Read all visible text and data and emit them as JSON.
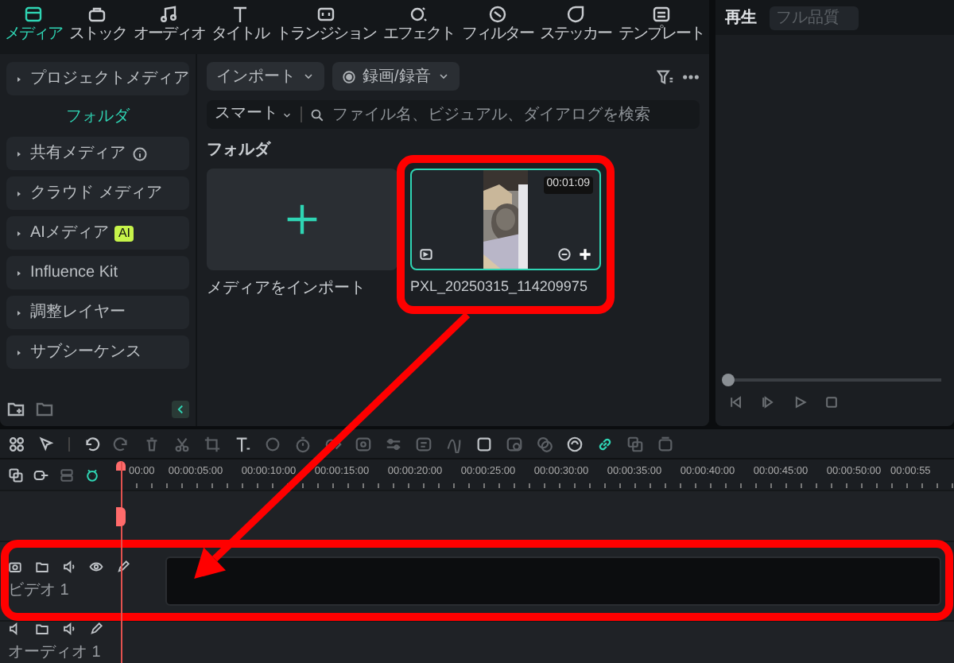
{
  "top_tabs": [
    {
      "label": "メディア",
      "selected": true
    },
    {
      "label": "ストック",
      "selected": false
    },
    {
      "label": "オーディオ",
      "selected": false
    },
    {
      "label": "タイトル",
      "selected": false
    },
    {
      "label": "トランジション",
      "selected": false
    },
    {
      "label": "エフェクト",
      "selected": false
    },
    {
      "label": "フィルター",
      "selected": false
    },
    {
      "label": "ステッカー",
      "selected": false
    },
    {
      "label": "テンプレート",
      "selected": false
    }
  ],
  "sidebar": {
    "items": [
      {
        "label": "プロジェクトメディア",
        "children": [
          {
            "label": "フォルダ",
            "selected": true
          }
        ]
      },
      {
        "label": "共有メディア",
        "kind": "info"
      },
      {
        "label": "クラウド メディア"
      },
      {
        "label": "AIメディア",
        "badge": "AI"
      },
      {
        "label": "Influence Kit"
      },
      {
        "label": "調整レイヤー"
      },
      {
        "label": "サブシーケンス"
      }
    ]
  },
  "media_toolbar": {
    "import_button": "インポート",
    "record_button": "録画/録音"
  },
  "search": {
    "filter": "スマート",
    "placeholder": "ファイル名、ビジュアル、ダイアログを検索"
  },
  "section_title": "フォルダ",
  "media_items": [
    {
      "kind": "import",
      "caption": "メディアをインポート",
      "selected": false,
      "highlighted": false
    },
    {
      "kind": "video",
      "caption": "PXL_20250315_114209975",
      "duration": "00:01:09",
      "selected": true,
      "highlighted": true
    }
  ],
  "player": {
    "title": "再生",
    "quality": "フル品質",
    "level": 0
  },
  "timeline": {
    "toolbar": {
      "link_active": true
    },
    "ruler": [
      "00:00",
      "00:00:05:00",
      "00:00:10:00",
      "00:00:15:00",
      "00:00:20:00",
      "00:00:25:00",
      "00:00:30:00",
      "00:00:35:00",
      "00:00:40:00",
      "00:00:45:00",
      "00:00:50:00",
      "00:00:55"
    ],
    "tracks": [
      {
        "label": "ビデオ 1",
        "kind": "video",
        "highlighted": true
      },
      {
        "label": "オーディオ 1",
        "kind": "audio",
        "highlighted": false
      }
    ]
  },
  "annotation_arrow": true
}
